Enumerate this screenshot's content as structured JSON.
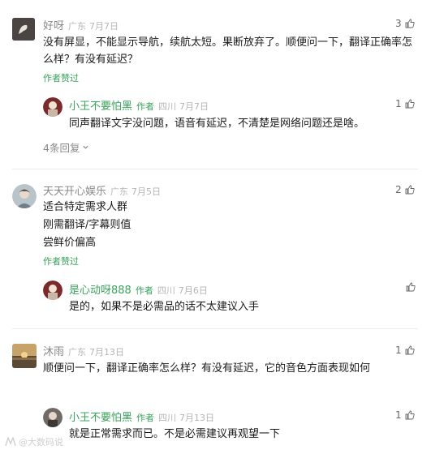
{
  "comments": [
    {
      "name": "好呀",
      "location": "广东",
      "date": "7月7日",
      "likes": "3",
      "text": "没有屏显，不能显示导航，续航太短。果断放弃了。顺便问一下，翻译正确率怎么样？有没有延迟？",
      "praised": "作者赞过",
      "reply": {
        "name": "小王不要怕黑",
        "author_tag": "作者",
        "location": "四川",
        "date": "7月7日",
        "likes": "1",
        "text": "同声翻译文字没问题，语音有延迟，不清楚是网络问题还是啥。"
      },
      "more_replies": "4条回复"
    },
    {
      "name": "天天开心娱乐",
      "location": "广东",
      "date": "7月5日",
      "likes": "2",
      "text_lines": [
        "适合特定需求人群",
        "刚需翻译/字幕则值",
        "尝鲜价偏高"
      ],
      "praised": "作者赞过",
      "reply": {
        "name": "是心动呀888",
        "author_tag": "作者",
        "location": "四川",
        "date": "7月6日",
        "text": "是的，如果不是必需品的话不太建议入手"
      }
    },
    {
      "name": "沐雨",
      "location": "广东",
      "date": "7月13日",
      "likes": "1",
      "text": "顺便问一下，翻译正确率怎么样？有没有延迟，它的音色方面表现如何",
      "reply": {
        "name": "小王不要怕黑",
        "author_tag": "作者",
        "location": "四川",
        "date": "7月13日",
        "likes": "1",
        "text": "就是正常需求而已。不是必需建议再观望一下"
      }
    }
  ],
  "watermark": "@大数码说"
}
